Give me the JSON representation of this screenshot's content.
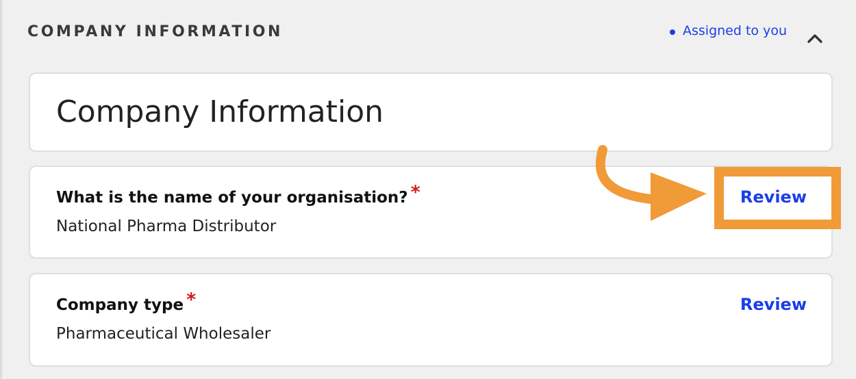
{
  "section": {
    "title": "COMPANY INFORMATION",
    "assigned_label": "Assigned to you"
  },
  "card_heading": "Company Information",
  "questions": [
    {
      "question": "What is the name of your organisation?",
      "required_mark": "*",
      "answer": "National Pharma Distributor",
      "review_label": "Review"
    },
    {
      "question": "Company type",
      "required_mark": "*",
      "answer": "Pharmaceutical Wholesaler",
      "review_label": "Review"
    }
  ],
  "colors": {
    "accent": "#1a3ee8",
    "required": "#d31b1b",
    "annotation": "#f19a38",
    "background": "#f0f0f0"
  },
  "icons": {
    "collapse": "chevron-up-icon",
    "assigned": "dot-icon",
    "annotation": "arrow-right-icon"
  }
}
